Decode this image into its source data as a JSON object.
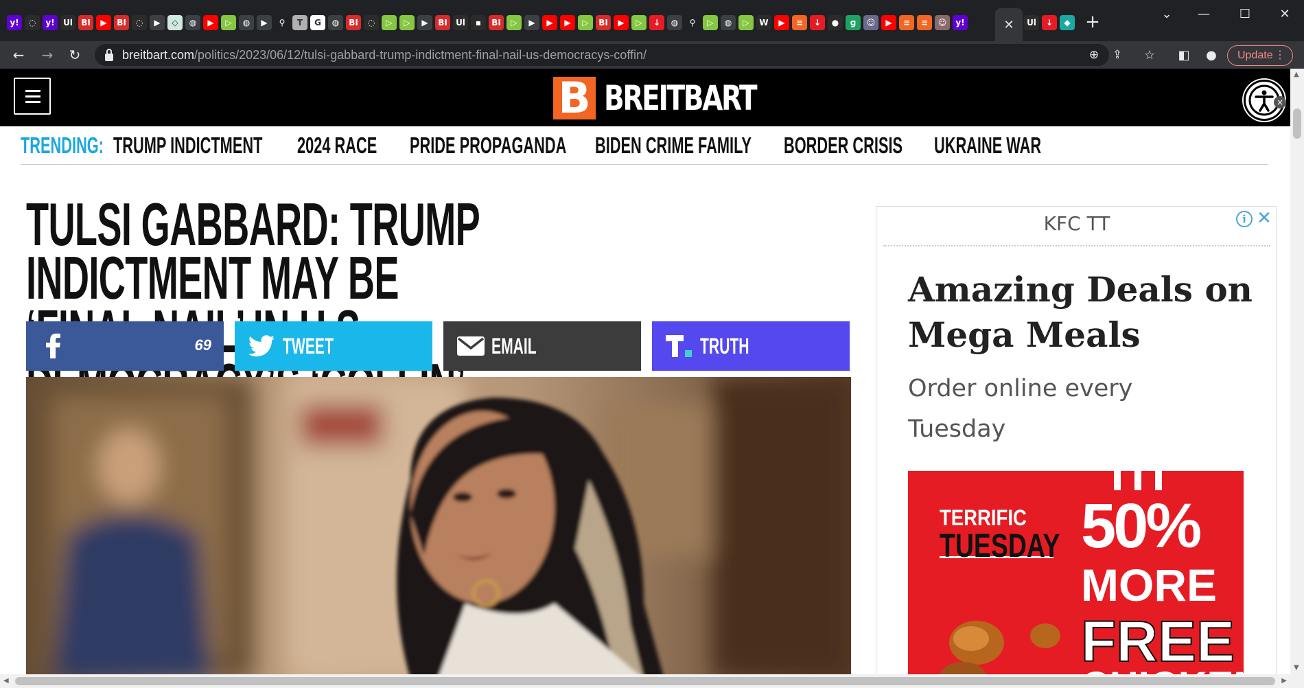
{
  "browser": {
    "tab_favicons": [
      {
        "name": "yahoo-icon",
        "glyph": "y!",
        "bg": "#5f01d1"
      },
      {
        "name": "tab-icon",
        "glyph": "◌",
        "bg": "#2b2b2b"
      },
      {
        "name": "yahoo-icon",
        "glyph": "y!",
        "bg": "#5f01d1"
      },
      {
        "name": "tab-icon",
        "glyph": "Ul",
        "bg": "#2b2b2b"
      },
      {
        "name": "bi-icon",
        "glyph": "BI",
        "bg": "#d62c2c"
      },
      {
        "name": "youtube-icon",
        "glyph": "▶",
        "bg": "#ff0000"
      },
      {
        "name": "bi-icon",
        "glyph": "BI",
        "bg": "#d62c2c"
      },
      {
        "name": "tab-icon",
        "glyph": "◌",
        "bg": "#2b2b2b"
      },
      {
        "name": "tab-icon",
        "glyph": "▶",
        "bg": "#3c4043"
      },
      {
        "name": "tab-icon",
        "glyph": "◇",
        "bg": "#cfe8e0"
      },
      {
        "name": "globe-icon",
        "glyph": "◍",
        "bg": "#3c4043"
      },
      {
        "name": "youtube-icon",
        "glyph": "▶",
        "bg": "#ff0000"
      },
      {
        "name": "rumble-icon",
        "glyph": "▷",
        "bg": "#85c742"
      },
      {
        "name": "globe-icon",
        "glyph": "◍",
        "bg": "#3c4043"
      },
      {
        "name": "tab-icon",
        "glyph": "▶",
        "bg": "#3c4043"
      },
      {
        "name": "search-icon",
        "glyph": "⚲",
        "bg": "#202124"
      },
      {
        "name": "tab-icon",
        "glyph": "T",
        "bg": "#b0b0b0"
      },
      {
        "name": "google-icon",
        "glyph": "G",
        "bg": "#ffffff"
      },
      {
        "name": "globe-icon",
        "glyph": "◍",
        "bg": "#3c4043"
      },
      {
        "name": "bi-icon",
        "glyph": "BI",
        "bg": "#d62c2c"
      },
      {
        "name": "tab-icon",
        "glyph": "◌",
        "bg": "#2b2b2b"
      },
      {
        "name": "rumble-icon",
        "glyph": "▷",
        "bg": "#85c742"
      },
      {
        "name": "rumble-icon",
        "glyph": "▷",
        "bg": "#85c742"
      },
      {
        "name": "tab-icon",
        "glyph": "▶",
        "bg": "#3c4043"
      },
      {
        "name": "bi-icon",
        "glyph": "BI",
        "bg": "#d62c2c"
      },
      {
        "name": "tab-icon",
        "glyph": "Ul",
        "bg": "#2b2b2b"
      },
      {
        "name": "tab-icon",
        "glyph": "▪",
        "bg": "#2b2b2b"
      },
      {
        "name": "bi-icon",
        "glyph": "BI",
        "bg": "#d62c2c"
      },
      {
        "name": "rumble-icon",
        "glyph": "▷",
        "bg": "#85c742"
      },
      {
        "name": "tab-icon",
        "glyph": "▶",
        "bg": "#3c4043"
      },
      {
        "name": "youtube-icon",
        "glyph": "▶",
        "bg": "#ff0000"
      },
      {
        "name": "youtube-icon",
        "glyph": "▶",
        "bg": "#ff0000"
      },
      {
        "name": "rumble-icon",
        "glyph": "▷",
        "bg": "#85c742"
      },
      {
        "name": "bi-icon",
        "glyph": "BI",
        "bg": "#d62c2c"
      },
      {
        "name": "youtube-icon",
        "glyph": "▶",
        "bg": "#ff0000"
      },
      {
        "name": "rumble-icon",
        "glyph": "▷",
        "bg": "#85c742"
      },
      {
        "name": "tab-icon",
        "glyph": "↓",
        "bg": "#e61c24"
      },
      {
        "name": "globe-icon",
        "glyph": "◍",
        "bg": "#3c4043"
      },
      {
        "name": "search-icon",
        "glyph": "⚲",
        "bg": "#202124"
      },
      {
        "name": "rumble-icon",
        "glyph": "▷",
        "bg": "#85c742"
      },
      {
        "name": "globe-icon",
        "glyph": "◍",
        "bg": "#3c4043"
      },
      {
        "name": "rumble-icon",
        "glyph": "▷",
        "bg": "#85c742"
      },
      {
        "name": "tab-icon",
        "glyph": "W",
        "bg": "#2b2b2b"
      },
      {
        "name": "youtube-icon",
        "glyph": "▶",
        "bg": "#ff0000"
      },
      {
        "name": "tab-icon",
        "glyph": "≡",
        "bg": "#f26522"
      },
      {
        "name": "tab-icon",
        "glyph": "↓",
        "bg": "#e61c24"
      },
      {
        "name": "tab-icon",
        "glyph": "●",
        "bg": "#2b2b2b"
      },
      {
        "name": "tab-icon",
        "glyph": "g",
        "bg": "#1da462"
      },
      {
        "name": "tab-icon",
        "glyph": "☺",
        "bg": "#6a6a8a"
      },
      {
        "name": "youtube-icon",
        "glyph": "▶",
        "bg": "#ff0000"
      },
      {
        "name": "tab-icon",
        "glyph": "≡",
        "bg": "#f26522"
      },
      {
        "name": "tab-icon",
        "glyph": "≡",
        "bg": "#f26522"
      },
      {
        "name": "tab-icon",
        "glyph": "☺",
        "bg": "#8a6a6a"
      },
      {
        "name": "yahoo-icon",
        "glyph": "y!",
        "bg": "#5f01d1"
      }
    ],
    "active_tab_close": "✕",
    "trailing_tab_favicons": [
      {
        "name": "tab-icon",
        "glyph": "Ul",
        "bg": "#2b2b2b"
      },
      {
        "name": "tab-icon",
        "glyph": "↓",
        "bg": "#e61c24"
      },
      {
        "name": "tab-icon",
        "glyph": "◆",
        "bg": "#1ba8a0"
      }
    ],
    "url_host": "breitbart.com",
    "url_path": "/politics/2023/06/12/tulsi-gabbard-trump-indictment-final-nail-us-democracys-coffin/",
    "update_label": "Update"
  },
  "site": {
    "logo_letter": "B",
    "logo_text": "BREITBART",
    "brand_color": "#f26522"
  },
  "trending": {
    "label": "TRENDING:",
    "items": [
      "TRUMP INDICTMENT",
      "2024 RACE",
      "PRIDE PROPAGANDA",
      "BIDEN CRIME FAMILY",
      "BORDER CRISIS",
      "UKRAINE WAR"
    ]
  },
  "article": {
    "headline_line1": "TULSI GABBARD: TRUMP INDICTMENT MAY BE",
    "headline_line2": "‘FINAL NAIL’ IN U.S. DEMOCRACY’S ‘COFFIN’",
    "share": {
      "facebook_count": "69",
      "tweet_label": "TWEET",
      "email_label": "EMAIL",
      "truth_label": "TRUTH"
    }
  },
  "ad": {
    "sponsor": "KFC TT",
    "title": "Amazing Deals on Mega Meals",
    "description": "Order online every Tuesday",
    "image_line1": "TERRIFIC",
    "image_line2": "TUESDAY",
    "image_big1": "50%",
    "image_big2": "MORE",
    "image_big3": "FREE",
    "image_big4": "CHICKEN"
  }
}
